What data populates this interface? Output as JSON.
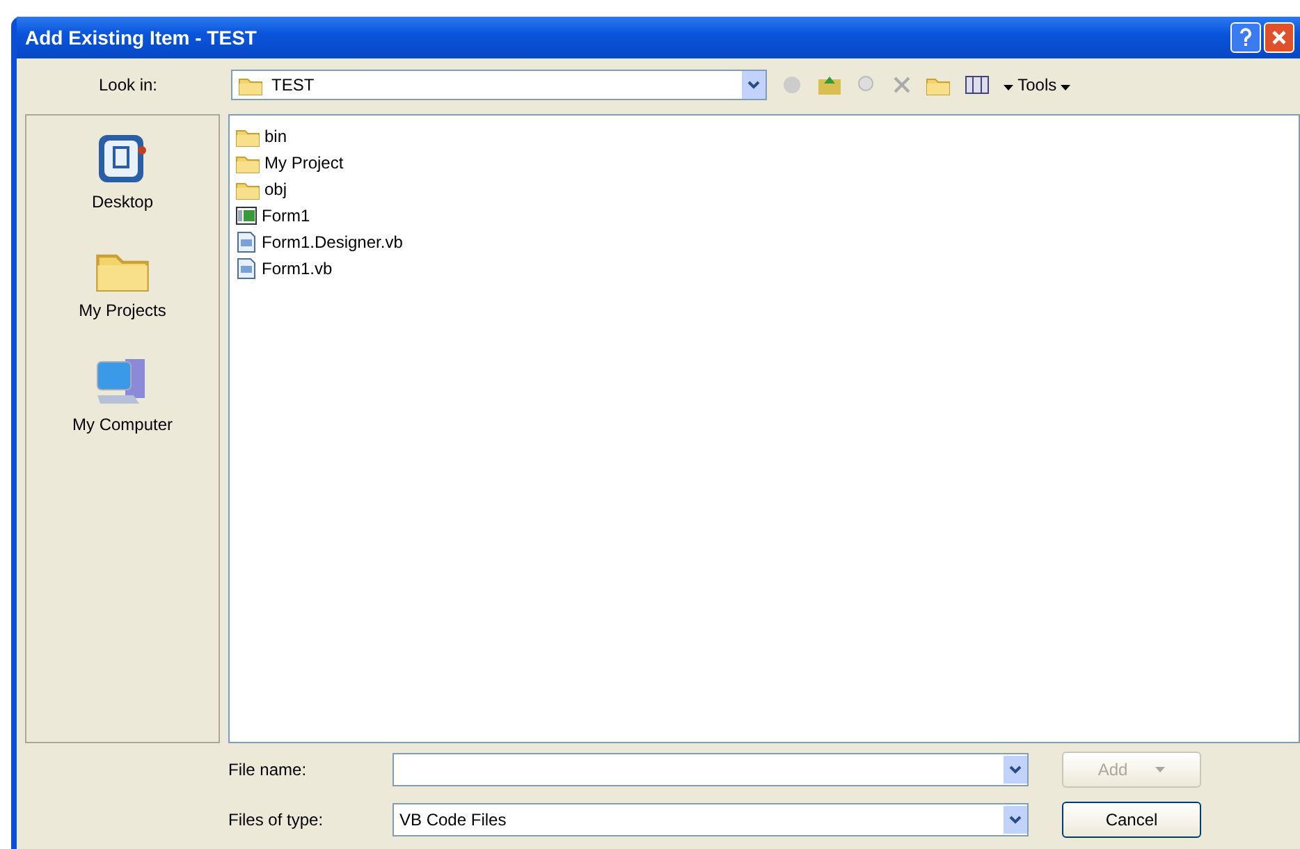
{
  "window": {
    "title": "Add Existing Item - TEST"
  },
  "look_in": {
    "label": "Look in:",
    "value": "TEST"
  },
  "toolbar": {
    "tools_label": "Tools"
  },
  "places": [
    {
      "label": "Desktop",
      "kind": "desktop"
    },
    {
      "label": "My Projects",
      "kind": "folder"
    },
    {
      "label": "My Computer",
      "kind": "computer"
    }
  ],
  "files": [
    {
      "name": "bin",
      "kind": "folder"
    },
    {
      "name": "My Project",
      "kind": "folder"
    },
    {
      "name": "obj",
      "kind": "folder"
    },
    {
      "name": "Form1",
      "kind": "form"
    },
    {
      "name": "Form1.Designer.vb",
      "kind": "code"
    },
    {
      "name": "Form1.vb",
      "kind": "code"
    }
  ],
  "file_name": {
    "label": "File name:"
  },
  "file_type": {
    "label": "Files of type:",
    "value": "VB Code Files"
  },
  "buttons": [
    {
      "label": "Add",
      "disabled": true,
      "has_menu": true
    },
    {
      "label": "Cancel",
      "disabled": false,
      "has_menu": false
    }
  ]
}
